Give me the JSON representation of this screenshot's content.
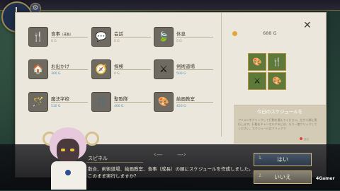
{
  "hud": {
    "settings_icon": "gear-icon"
  },
  "activities": [
    {
      "name": "食事",
      "sub": "（成長）",
      "price": "0 G",
      "price_blue": false,
      "icon": "food-icon",
      "glyph": "🍴"
    },
    {
      "name": "会話",
      "sub": "",
      "price": "0 G",
      "price_blue": false,
      "icon": "speech-icon",
      "glyph": "💬"
    },
    {
      "name": "休息",
      "sub": "",
      "price": "0 G",
      "price_blue": false,
      "icon": "rest-icon",
      "glyph": "🍃"
    },
    {
      "name": "お出かけ",
      "sub": "",
      "price": "300 G",
      "price_blue": true,
      "icon": "outing-icon",
      "glyph": "🏠"
    },
    {
      "name": "探検",
      "sub": "",
      "price": "0 G",
      "price_blue": false,
      "icon": "explore-icon",
      "glyph": "🧭"
    },
    {
      "name": "剣術道場",
      "sub": "",
      "price": "500 G",
      "price_blue": true,
      "icon": "sword-icon",
      "glyph": "⚔"
    },
    {
      "name": "魔法学校",
      "sub": "",
      "price": "510 G",
      "price_blue": true,
      "icon": "magic-icon",
      "glyph": "🪄"
    },
    {
      "name": "聖歌隊",
      "sub": "",
      "price": "400 G",
      "price_blue": true,
      "icon": "choir-icon",
      "glyph": "🎵"
    },
    {
      "name": "絵画教室",
      "sub": "",
      "price": "450 G",
      "price_blue": true,
      "icon": "painting-icon",
      "glyph": "🎨"
    }
  ],
  "gold": {
    "value": "688 G",
    "icon": "coin-icon"
  },
  "close_icon": "close-icon",
  "schedule": {
    "slots": [
      {
        "icon": "painting-icon",
        "glyph": "🎨"
      },
      {
        "icon": "food-icon",
        "glyph": "🍴"
      },
      {
        "icon": "sword-icon",
        "glyph": "⚔"
      },
      {
        "icon": "painting-icon",
        "glyph": "🎨"
      }
    ],
    "title": "今日のスケジュールを",
    "text": "アイコンをクリックして行動を選んでください。左から順に実行します。行動をキャンセルするには、もう一度クリックしてください。スケジュールはクリックで",
    "hint": "確認"
  },
  "dialog": {
    "speaker": "スピネル",
    "text": "散合、剣術道場、絵画教室、食事（成長）の順にスケジュールを作成しました。\nこのまま実行しますか？",
    "yes_num": "1.",
    "yes_label": "はい",
    "no_num": "2.",
    "no_label": "いいえ"
  },
  "watermark": "4Gamer"
}
